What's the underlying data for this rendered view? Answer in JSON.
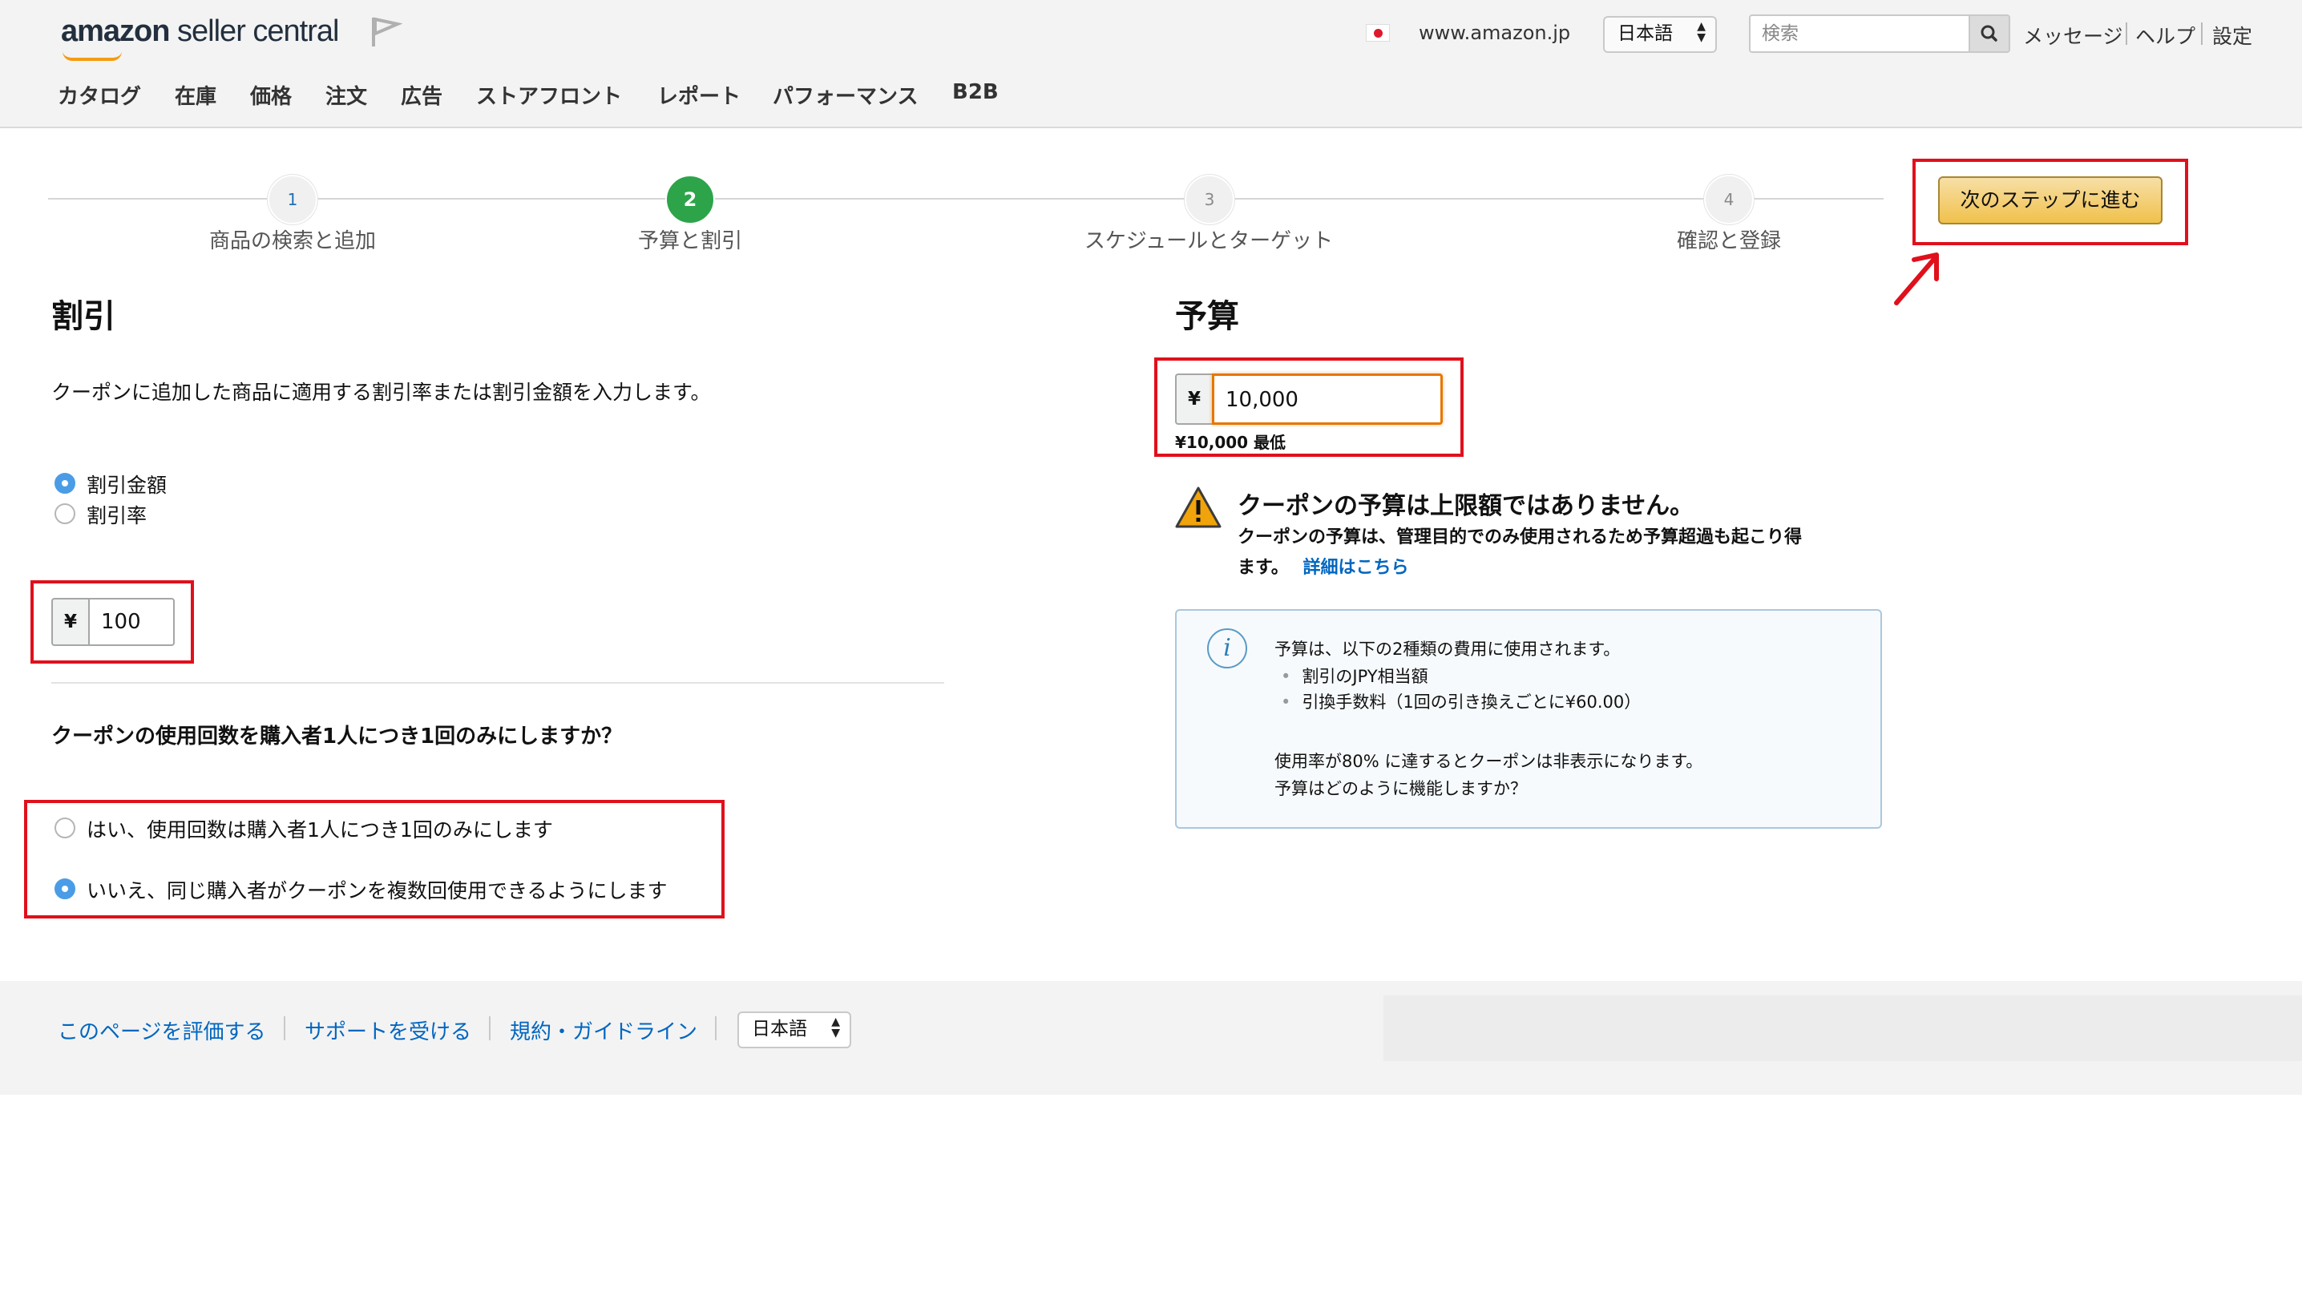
{
  "header": {
    "logo": {
      "bold": "amazon",
      "light": " seller central"
    },
    "marketplace": "www.amazon.jp",
    "language": "日本語",
    "search_placeholder": "検索",
    "links": [
      "メッセージ",
      "ヘルプ",
      "設定"
    ],
    "nav": [
      "カタログ",
      "在庫",
      "価格",
      "注文",
      "広告",
      "ストアフロント",
      "レポート",
      "パフォーマンス",
      "B2B"
    ]
  },
  "progress": {
    "steps": [
      {
        "number": "1",
        "label": "商品の検索と追加"
      },
      {
        "number": "2",
        "label": "予算と割引"
      },
      {
        "number": "3",
        "label": "スケジュールとターゲット"
      },
      {
        "number": "4",
        "label": "確認と登録"
      }
    ],
    "current_step": 2
  },
  "next_button": "次のステップに進む",
  "discount": {
    "title": "割引",
    "description": "クーポンに追加した商品に適用する割引率または割引金額を入力します。",
    "options": [
      "割引金額",
      "割引率"
    ],
    "selected_option": "割引金額",
    "currency": "¥",
    "value": "100",
    "limit_question": "クーポンの使用回数を購入者1人につき1回のみにしますか？",
    "limit_options": [
      "はい、使用回数は購入者1人につき1回のみにします",
      "いいえ、同じ購入者がクーポンを複数回使用できるようにします"
    ],
    "limit_selected": "いいえ、同じ購入者がクーポンを複数回使用できるようにします"
  },
  "budget": {
    "title": "予算",
    "currency": "¥",
    "value": "10,000",
    "minimum": "¥10,000 最低",
    "warning_title": "クーポンの予算は上限額ではありません。",
    "warning_line1": "クーポンの予算は、管理目的でのみ使用されるため予算超過も起こり得",
    "warning_line2": "ます。",
    "warning_link": "詳細はこちら",
    "info_intro": "予算は、以下の2種類の費用に使用されます。",
    "info_bullets": [
      "割引のJPY相当額",
      "引換手数料（1回の引き換えごとに¥60.00）"
    ],
    "info_note": "使用率が80% に達するとクーポンは非表示になります。",
    "info_link": "予算はどのように機能しますか？"
  },
  "footer": {
    "links": [
      "このページを評価する",
      "サポートを受ける",
      "規約・ガイドライン"
    ],
    "language": "日本語"
  },
  "colors": {
    "annotation_red": "#e0101c",
    "step_active": "#2da44a",
    "button_yellow": "#f0c14b",
    "link_blue": "#0066c0"
  },
  "icons": [
    "flag-icon",
    "jp-flag-icon",
    "search-icon",
    "warning-icon",
    "info-icon",
    "select-arrows-icon"
  ]
}
